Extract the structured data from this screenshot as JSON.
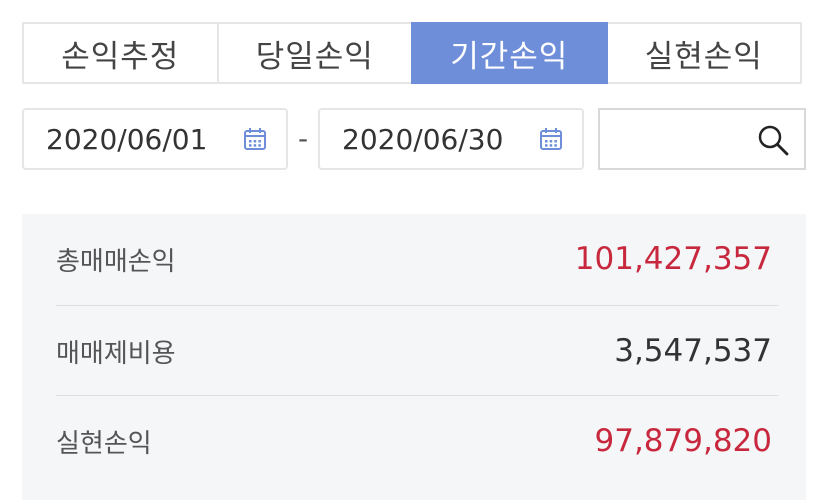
{
  "tabs": [
    {
      "label": "손익추정"
    },
    {
      "label": "당일손익"
    },
    {
      "label": "기간손익"
    },
    {
      "label": "실현손익"
    }
  ],
  "active_tab_index": 2,
  "date_range": {
    "from": "2020/06/01",
    "separator": "-",
    "to": "2020/06/30",
    "icon": "calendar-icon"
  },
  "search": {
    "value": "",
    "placeholder": "",
    "icon": "search-icon"
  },
  "summary": {
    "rows": [
      {
        "label": "총매매손익",
        "value": "101,427,357",
        "tone": "profit"
      },
      {
        "label": "매매제비용",
        "value": "3,547,537",
        "tone": "neutral"
      },
      {
        "label": "실현손익",
        "value": "97,879,820",
        "tone": "profit"
      }
    ]
  },
  "colors": {
    "accent": "#6f8ed9",
    "profit": "#c8283d",
    "panel_bg": "#f5f6f8"
  }
}
